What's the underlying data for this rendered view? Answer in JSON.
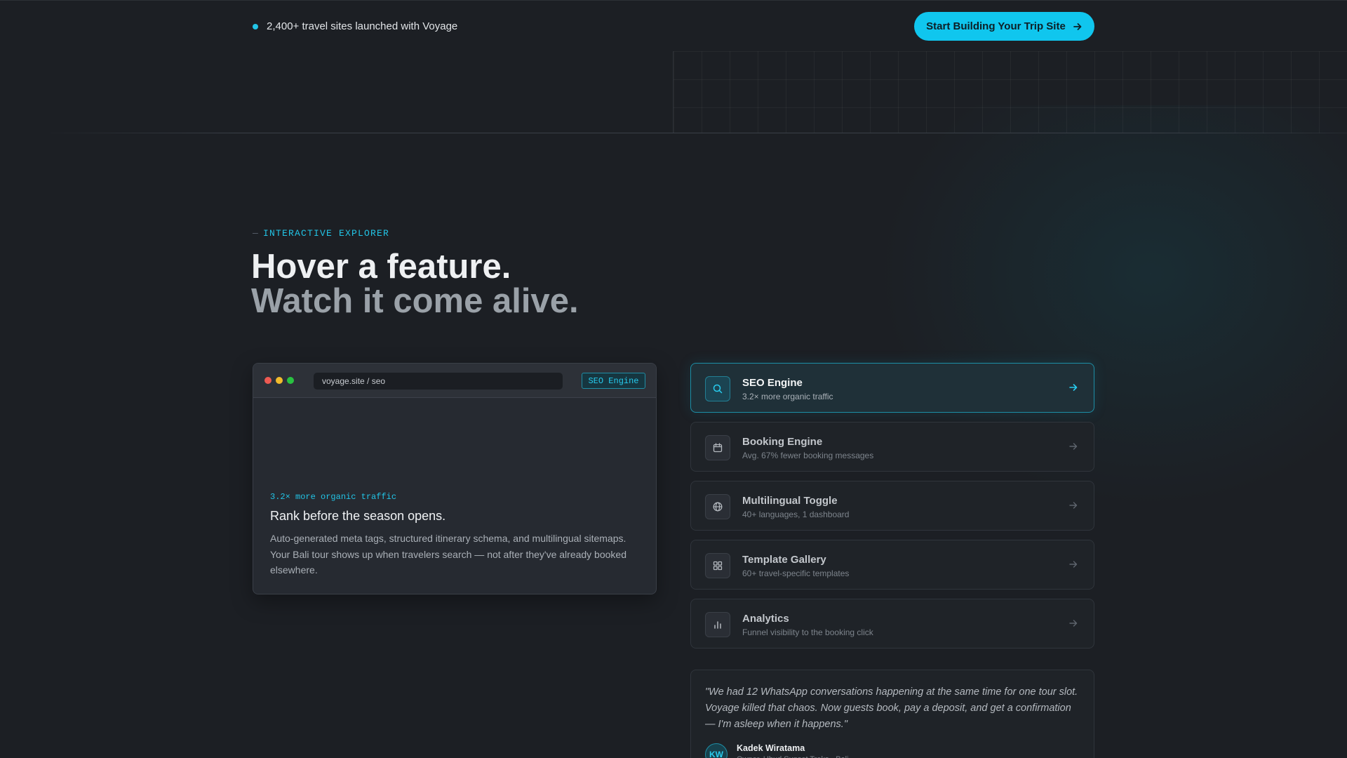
{
  "topbar": {
    "social_proof": "2,400+ travel sites launched with Voyage",
    "cta_label": "Start Building Your Trip Site"
  },
  "hero": {
    "eyebrow_dash": "—",
    "eyebrow": "INTERACTIVE EXPLORER",
    "headline": "Hover a feature.",
    "subheadline": "Watch it come alive."
  },
  "preview": {
    "url": "voyage.site / seo",
    "badge": "SEO Engine",
    "stat": "3.2× more organic traffic",
    "title": "Rank before the season opens.",
    "description": "Auto-generated meta tags, structured itinerary schema, and multilingual sitemaps. Your Bali tour shows up when travelers search — not after they've already booked elsewhere."
  },
  "features": [
    {
      "name": "SEO Engine",
      "subtitle": "3.2× more organic traffic",
      "icon": "search-icon",
      "active": true
    },
    {
      "name": "Booking Engine",
      "subtitle": "Avg. 67% fewer booking messages",
      "icon": "calendar-icon",
      "active": false
    },
    {
      "name": "Multilingual Toggle",
      "subtitle": "40+ languages, 1 dashboard",
      "icon": "globe-icon",
      "active": false
    },
    {
      "name": "Template Gallery",
      "subtitle": "60+ travel-specific templates",
      "icon": "grid-icon",
      "active": false
    },
    {
      "name": "Analytics",
      "subtitle": "Funnel visibility to the booking click",
      "icon": "bar-chart-icon",
      "active": false
    }
  ],
  "testimonial": {
    "quote": "\"We had 12 WhatsApp conversations happening at the same time for one tour slot. Voyage killed that chaos. Now guests book, pay a deposit, and get a confirmation — I'm asleep when it happens.\"",
    "initials": "KW",
    "author": "Kadek Wiratama",
    "role": "Owner, Ubud Sunset Treks · Bali"
  },
  "colors": {
    "background": "#1c1f24",
    "accent": "#10c6ee",
    "card": "#262a31"
  }
}
